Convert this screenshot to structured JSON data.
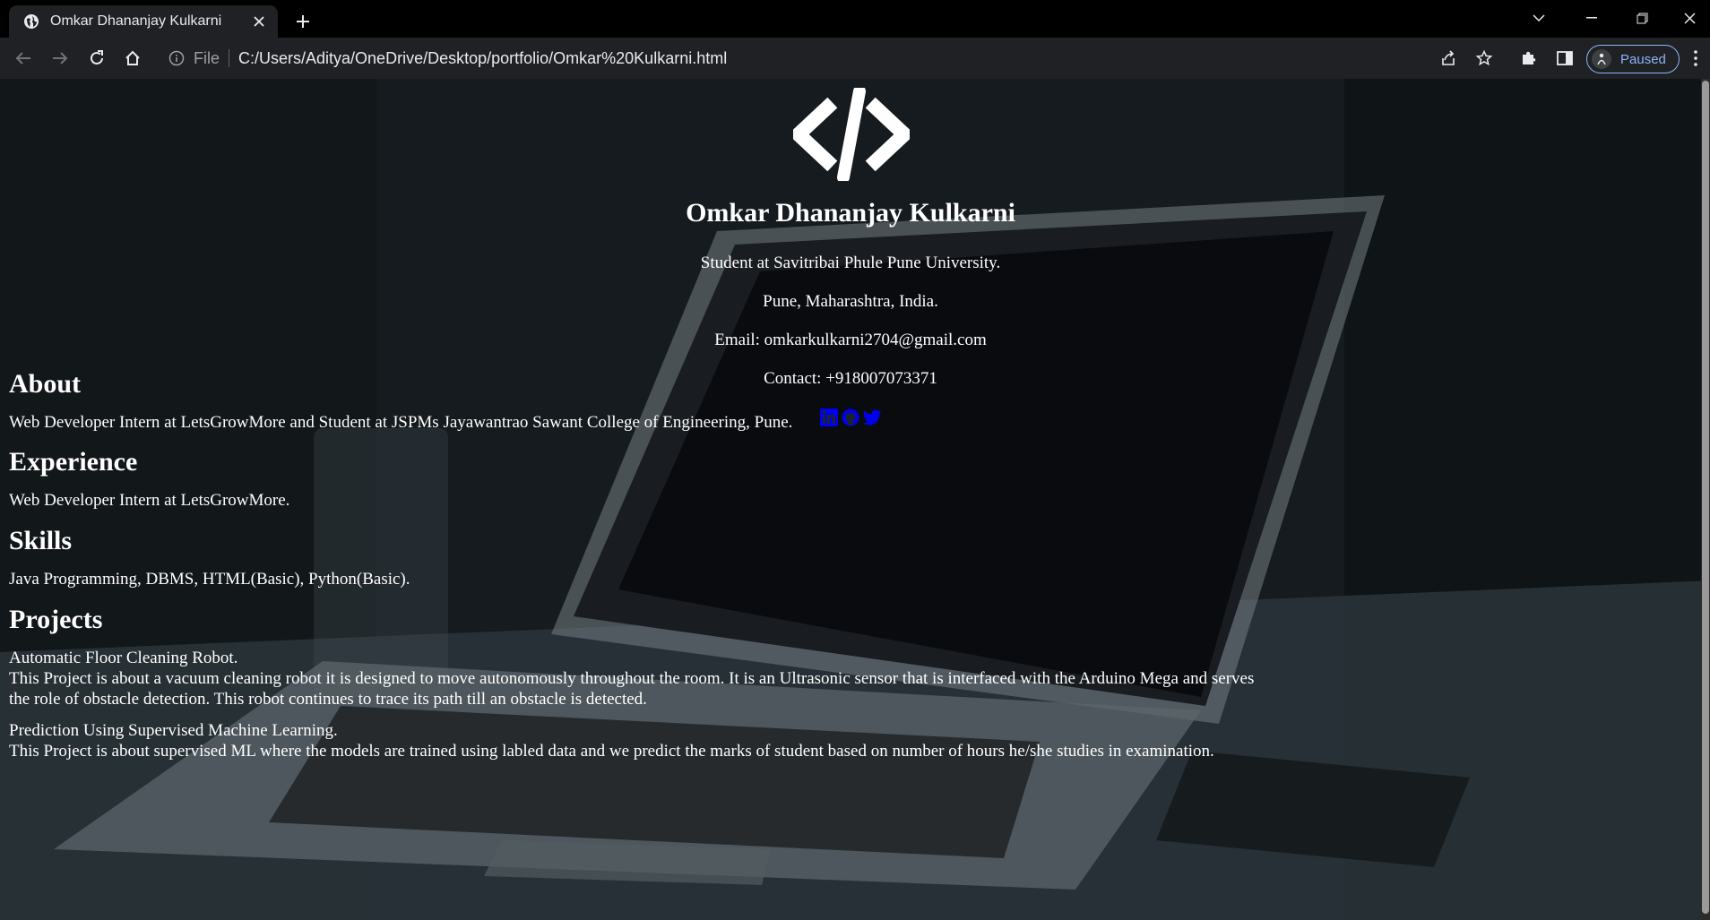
{
  "browser": {
    "tab": {
      "title": "Omkar Dhananjay Kulkarni"
    },
    "omnibox": {
      "scheme_label": "File",
      "url": "C:/Users/Aditya/OneDrive/Desktop/portfolio/Omkar%20Kulkarni.html"
    },
    "profile": {
      "status": "Paused"
    }
  },
  "page": {
    "name": "Omkar Dhananjay Kulkarni",
    "tagline": "Student at Savitribai Phule Pune University.",
    "location": "Pune, Maharashtra, India.",
    "email": "Email: omkarkulkarni2704@gmail.com",
    "contact": "Contact: +918007073371",
    "social_icons": [
      "linkedin-icon",
      "github-icon",
      "twitter-icon"
    ],
    "link_color": "#0000ee",
    "about": {
      "heading": "About",
      "text": "Web Developer Intern at LetsGrowMore and Student at JSPMs Jayawantrao Sawant College of Engineering, Pune."
    },
    "experience": {
      "heading": "Experience",
      "text": "Web Developer Intern at LetsGrowMore."
    },
    "skills": {
      "heading": "Skills",
      "text": "Java Programming, DBMS, HTML(Basic), Python(Basic)."
    },
    "projects": {
      "heading": "Projects",
      "items": [
        {
          "title": "Automatic Floor Cleaning Robot.",
          "line1": "This Project is about a vacuum cleaning robot it is designed to move autonomously throughout the room. It is an Ultrasonic sensor that is interfaced with the Arduino Mega and serves",
          "line2": "the role of obstacle detection. This robot continues to trace its path till an obstacle is detected."
        },
        {
          "title": "Prediction Using Supervised Machine Learning.",
          "line1": "This Project is about supervised ML where the models are trained using labled data and we predict the marks of student based on number of hours he/she studies in examination."
        }
      ]
    }
  }
}
